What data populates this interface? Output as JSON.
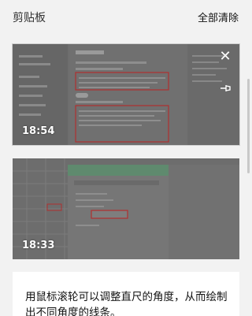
{
  "header": {
    "title": "剪贴板",
    "clear_all_label": "全部清除"
  },
  "items": [
    {
      "type": "image",
      "time": "18:54",
      "selected": true
    },
    {
      "type": "image",
      "time": "18:33",
      "selected": false
    },
    {
      "type": "text",
      "text": "用鼠标滚轮可以调整直尺的角度，从而绘制出不同角度的线条。"
    }
  ],
  "icons": {
    "close": "close-icon",
    "pin": "pin-icon"
  },
  "colors": {
    "background": "#f2f2f2",
    "thumbnail_overlay": "#6b6b6b",
    "highlight_box": "#b03030"
  }
}
